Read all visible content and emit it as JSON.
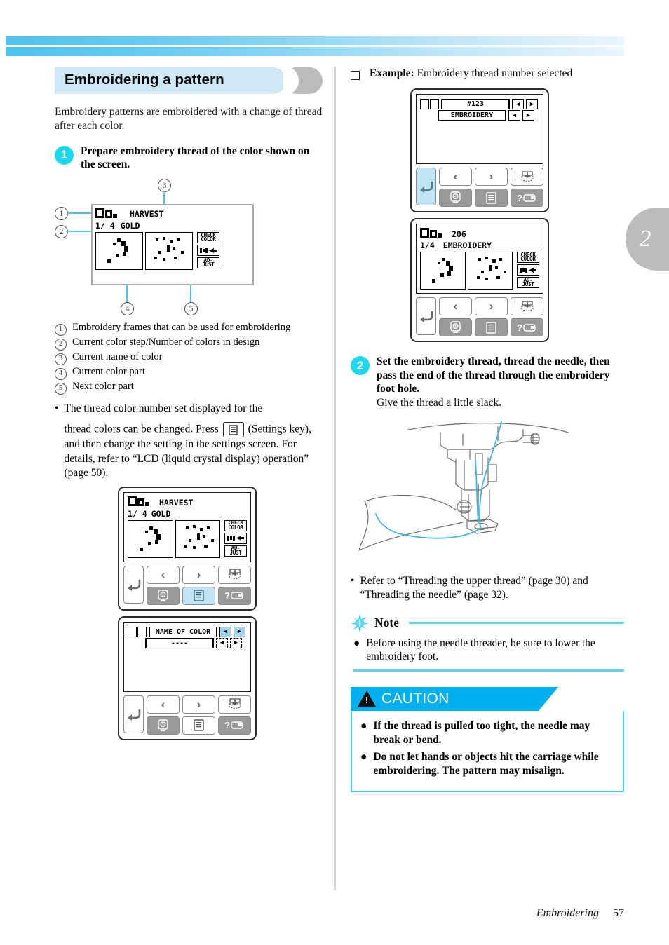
{
  "page": {
    "footer_section": "Embroidering",
    "footer_page": "57",
    "chapter_tab": "2"
  },
  "left": {
    "heading": "Embroidering a pattern",
    "intro": "Embroidery patterns are embroidered with a change of thread after each color.",
    "step1": {
      "number": "1",
      "text": "Prepare embroidery thread of the color shown on the screen."
    },
    "callout_numbers": [
      "1",
      "2",
      "3",
      "4",
      "5"
    ],
    "legend": [
      {
        "num": "1",
        "text": "Embroidery frames that can be used for embroidering"
      },
      {
        "num": "2",
        "text": "Current color step/Number of colors in design"
      },
      {
        "num": "3",
        "text": "Current name of color"
      },
      {
        "num": "4",
        "text": "Current color part"
      },
      {
        "num": "5",
        "text": "Next color part"
      }
    ],
    "note_bullet_a": "The thread color number set displayed for the",
    "note_bullet_b": "thread colors can be changed. Press",
    "note_bullet_c": "(Settings key), and then change the setting in the settings screen. For details, refer to “LCD (liquid crystal display) operation” (page 50)."
  },
  "lcd_main": {
    "color_name_line1": "HARVEST",
    "step_counter": "1/  4",
    "color_name_line2": "GOLD",
    "sidekey_check_a": "CHECK",
    "sidekey_check_b": "COLOR",
    "sidekey_thread": "thread-icon",
    "sidekey_adj_a": "AD-",
    "sidekey_adj_b": "JUST",
    "key_back": "return-arrow",
    "key_prev": "‹",
    "key_next": "›",
    "key_needle": "needle-position-icon",
    "key_bobbin": "bobbin-winding-icon",
    "key_settings": "settings-icon",
    "key_help": "?"
  },
  "lcd_settings": {
    "field_label": "NAME OF COLOR",
    "field_value": "----",
    "icon": "lcd-settings-icon"
  },
  "right": {
    "example_label": "Example:",
    "example_text": "Embroidery thread number selected",
    "lcd_number": {
      "number": "#123",
      "brand": "EMBROIDERY"
    },
    "lcd_result": {
      "thread_number": "206",
      "step_counter": "1/4",
      "brand": "EMBROIDERY",
      "sidekey_check_a": "CHECK",
      "sidekey_check_b": "COLOR",
      "sidekey_adj_a": "AD-",
      "sidekey_adj_b": "JUST"
    },
    "step2": {
      "number": "2",
      "bold_text": "Set the embroidery thread, thread the needle, then pass the end of the thread through the embroidery foot hole.",
      "plain_text": "Give the thread a little slack."
    },
    "refer_bullet": "Refer to “Threading the upper thread” (page 30) and “Threading the needle” (page 32).",
    "note": {
      "title": "Note",
      "body": "Before using the needle threader, be sure to lower the embroidery foot."
    },
    "caution": {
      "title": "CAUTION",
      "items": [
        "If the thread is pulled too tight, the needle may break or bend.",
        "Do not let hands or objects hit the carriage while embroidering. The pattern may misalign."
      ]
    }
  },
  "colors": {
    "accent_cyan": "#1ad9ee",
    "header_blue": "#4fc3ef",
    "heading_pill": "#cfe8f5",
    "caution_blue": "#00b0ef",
    "caution_border": "#3fd0ee",
    "tab_gray": "#bcbcbc",
    "lcd_select": "#bfe4f5"
  }
}
